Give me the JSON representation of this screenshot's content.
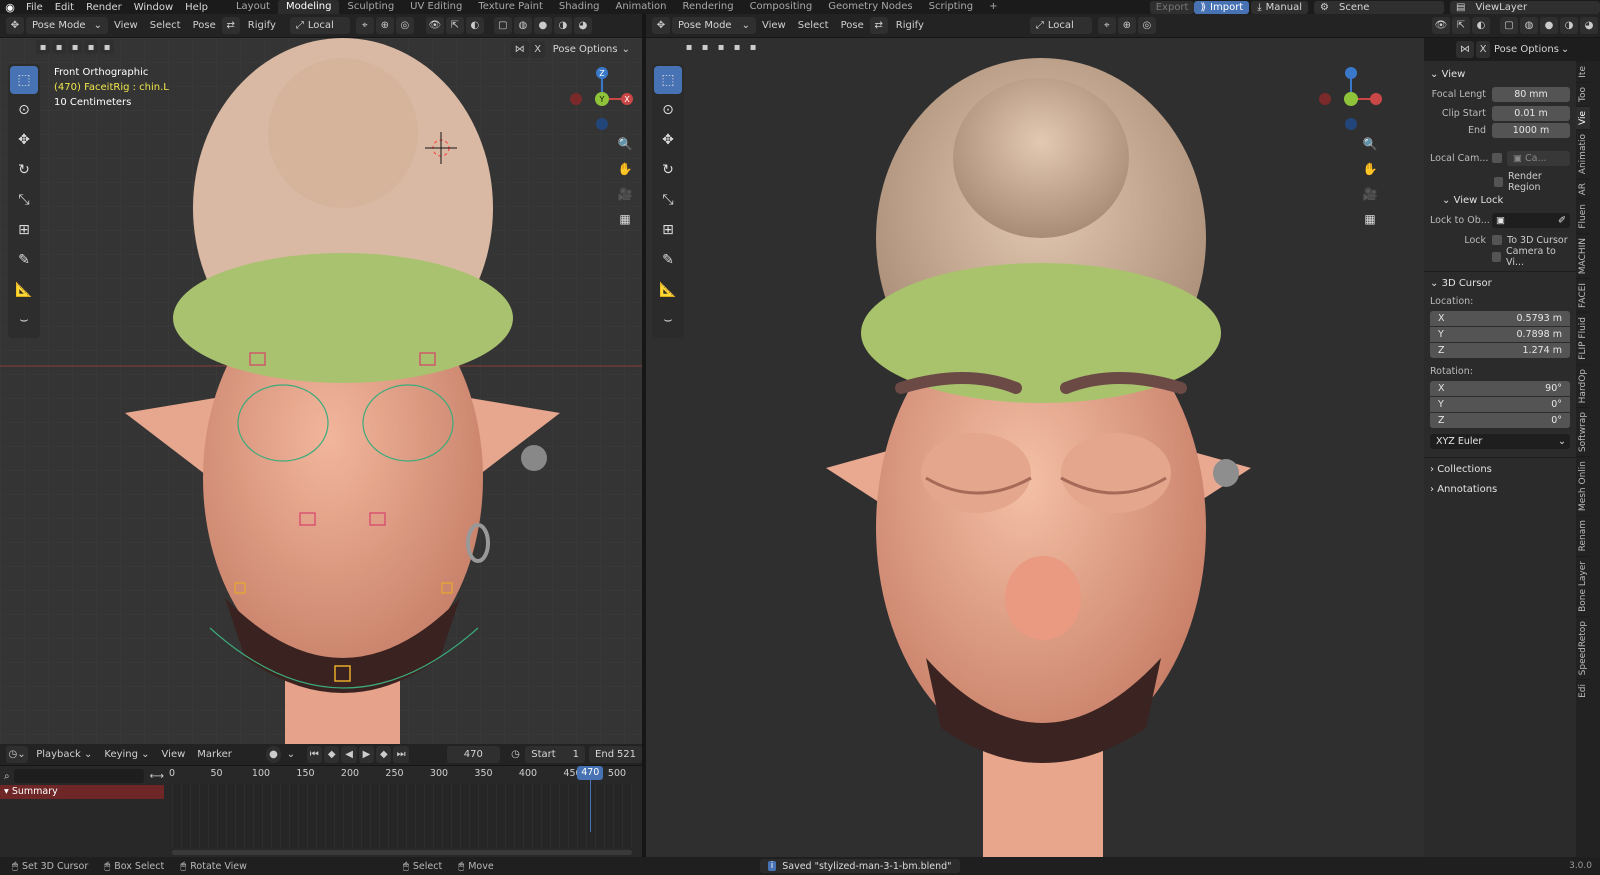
{
  "topbar": {
    "menus": [
      "File",
      "Edit",
      "Render",
      "Window",
      "Help"
    ],
    "workspaces": [
      "Layout",
      "Modeling",
      "Sculpting",
      "UV Editing",
      "Texture Paint",
      "Shading",
      "Animation",
      "Rendering",
      "Compositing",
      "Geometry Nodes",
      "Scripting"
    ],
    "active_workspace": "Modeling",
    "export_label": "Export",
    "import_label": "Import",
    "manual_label": "Manual",
    "scene": "Scene",
    "view_layer": "ViewLayer"
  },
  "left_viewport": {
    "mode": "Pose Mode",
    "menus": [
      "View",
      "Select",
      "Pose",
      "Rigify"
    ],
    "transform_orientation": "Local",
    "pose_options": "Pose Options",
    "overlay_lines": [
      "Front Orthographic",
      "(470) FaceitRig : chin.L",
      "10 Centimeters"
    ],
    "gizmo_axes": [
      "Z",
      "Y",
      "X"
    ]
  },
  "right_viewport": {
    "mode": "Pose Mode",
    "menus": [
      "View",
      "Select",
      "Pose",
      "Rigify"
    ],
    "transform_orientation": "Local",
    "pose_options": "Pose Options"
  },
  "npanel": {
    "view_header": "View",
    "focal_length_label": "Focal Lengt",
    "focal_length": "80 mm",
    "clip_start_label": "Clip Start",
    "clip_start": "0.01 m",
    "end_label": "End",
    "end": "1000 m",
    "local_camera_label": "Local Cam...",
    "local_camera_value": "Ca...",
    "render_region": "Render Region",
    "view_lock_header": "View Lock",
    "lock_to_object_label": "Lock to Ob...",
    "lock_label": "Lock",
    "to_3d_cursor": "To 3D Cursor",
    "camera_to_view": "Camera to Vi...",
    "cursor_header": "3D Cursor",
    "location_label": "Location:",
    "location": [
      {
        "axis": "X",
        "value": "0.5793 m"
      },
      {
        "axis": "Y",
        "value": "0.7898 m"
      },
      {
        "axis": "Z",
        "value": "1.274 m"
      }
    ],
    "rotation_label": "Rotation:",
    "rotation": [
      {
        "axis": "X",
        "value": "90°"
      },
      {
        "axis": "Y",
        "value": "0°"
      },
      {
        "axis": "Z",
        "value": "0°"
      }
    ],
    "rotation_mode": "XYZ Euler",
    "collections": "Collections",
    "annotations": "Annotations"
  },
  "side_tabs": [
    "Ite",
    "Too",
    "Vie",
    "Animatio",
    "AR",
    "Fluen",
    "MACHIN",
    "FACEI",
    "FLIP Fluid",
    "HardOp",
    "Softwrap",
    "Mesh Onlin",
    "Renam",
    "Bone Layer",
    "SpeedRetop",
    "Edi"
  ],
  "timeline": {
    "menus": [
      "Playback",
      "Keying",
      "View",
      "Marker"
    ],
    "current_frame": "470",
    "start_label": "Start",
    "start": "1",
    "end_label": "End",
    "end": "521",
    "ticks": [
      "0",
      "50",
      "100",
      "150",
      "200",
      "250",
      "300",
      "350",
      "400",
      "450",
      "500"
    ],
    "playhead": "470",
    "playhead_fraction": 0.94,
    "summary": "Summary"
  },
  "status": {
    "left_items": [
      "Set 3D Cursor",
      "Box Select",
      "Rotate View"
    ],
    "right_items": [
      "Select",
      "Move"
    ],
    "message": "Saved \"stylized-man-3-1-bm.blend\"",
    "version": "3.0.0"
  }
}
